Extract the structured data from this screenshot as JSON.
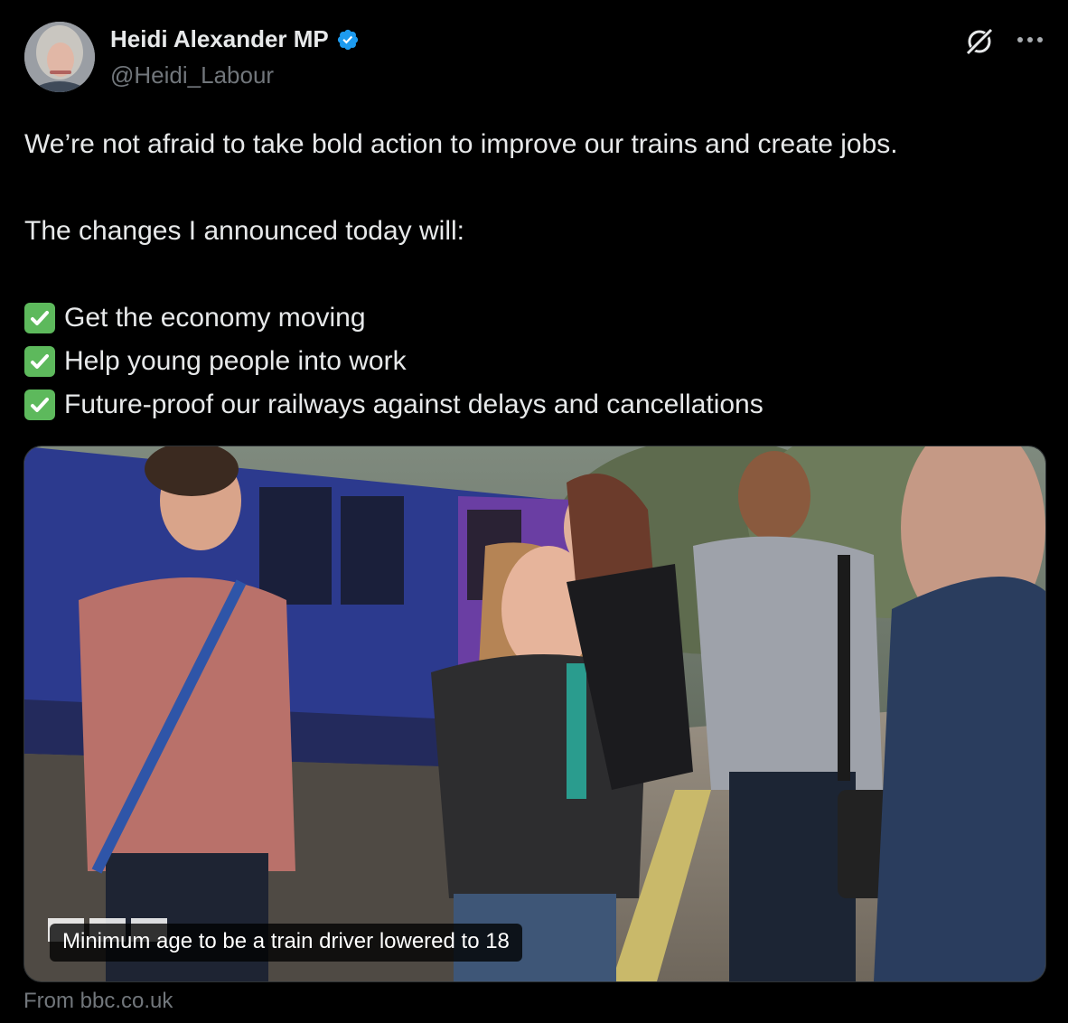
{
  "author": {
    "name": "Heidi Alexander MP",
    "handle": "@Heidi_Labour",
    "verified": true
  },
  "actions": {
    "grok_icon": "grok-icon",
    "more_icon": "more-dots-icon"
  },
  "tweet": {
    "line1": "We’re not afraid to take bold action to improve our trains and create jobs.",
    "line2": "The changes I announced today will:",
    "bullets": [
      "Get the economy moving",
      "Help young people into work",
      "Future-proof our railways against delays and cancellations"
    ]
  },
  "card": {
    "title": "Minimum age to be a train driver lowered to 18",
    "source": "From bbc.co.uk",
    "logo_text": "BBC NEWS"
  },
  "colors": {
    "verified": "#1d9bf0",
    "check": "#5db95c",
    "muted": "#71767b"
  }
}
